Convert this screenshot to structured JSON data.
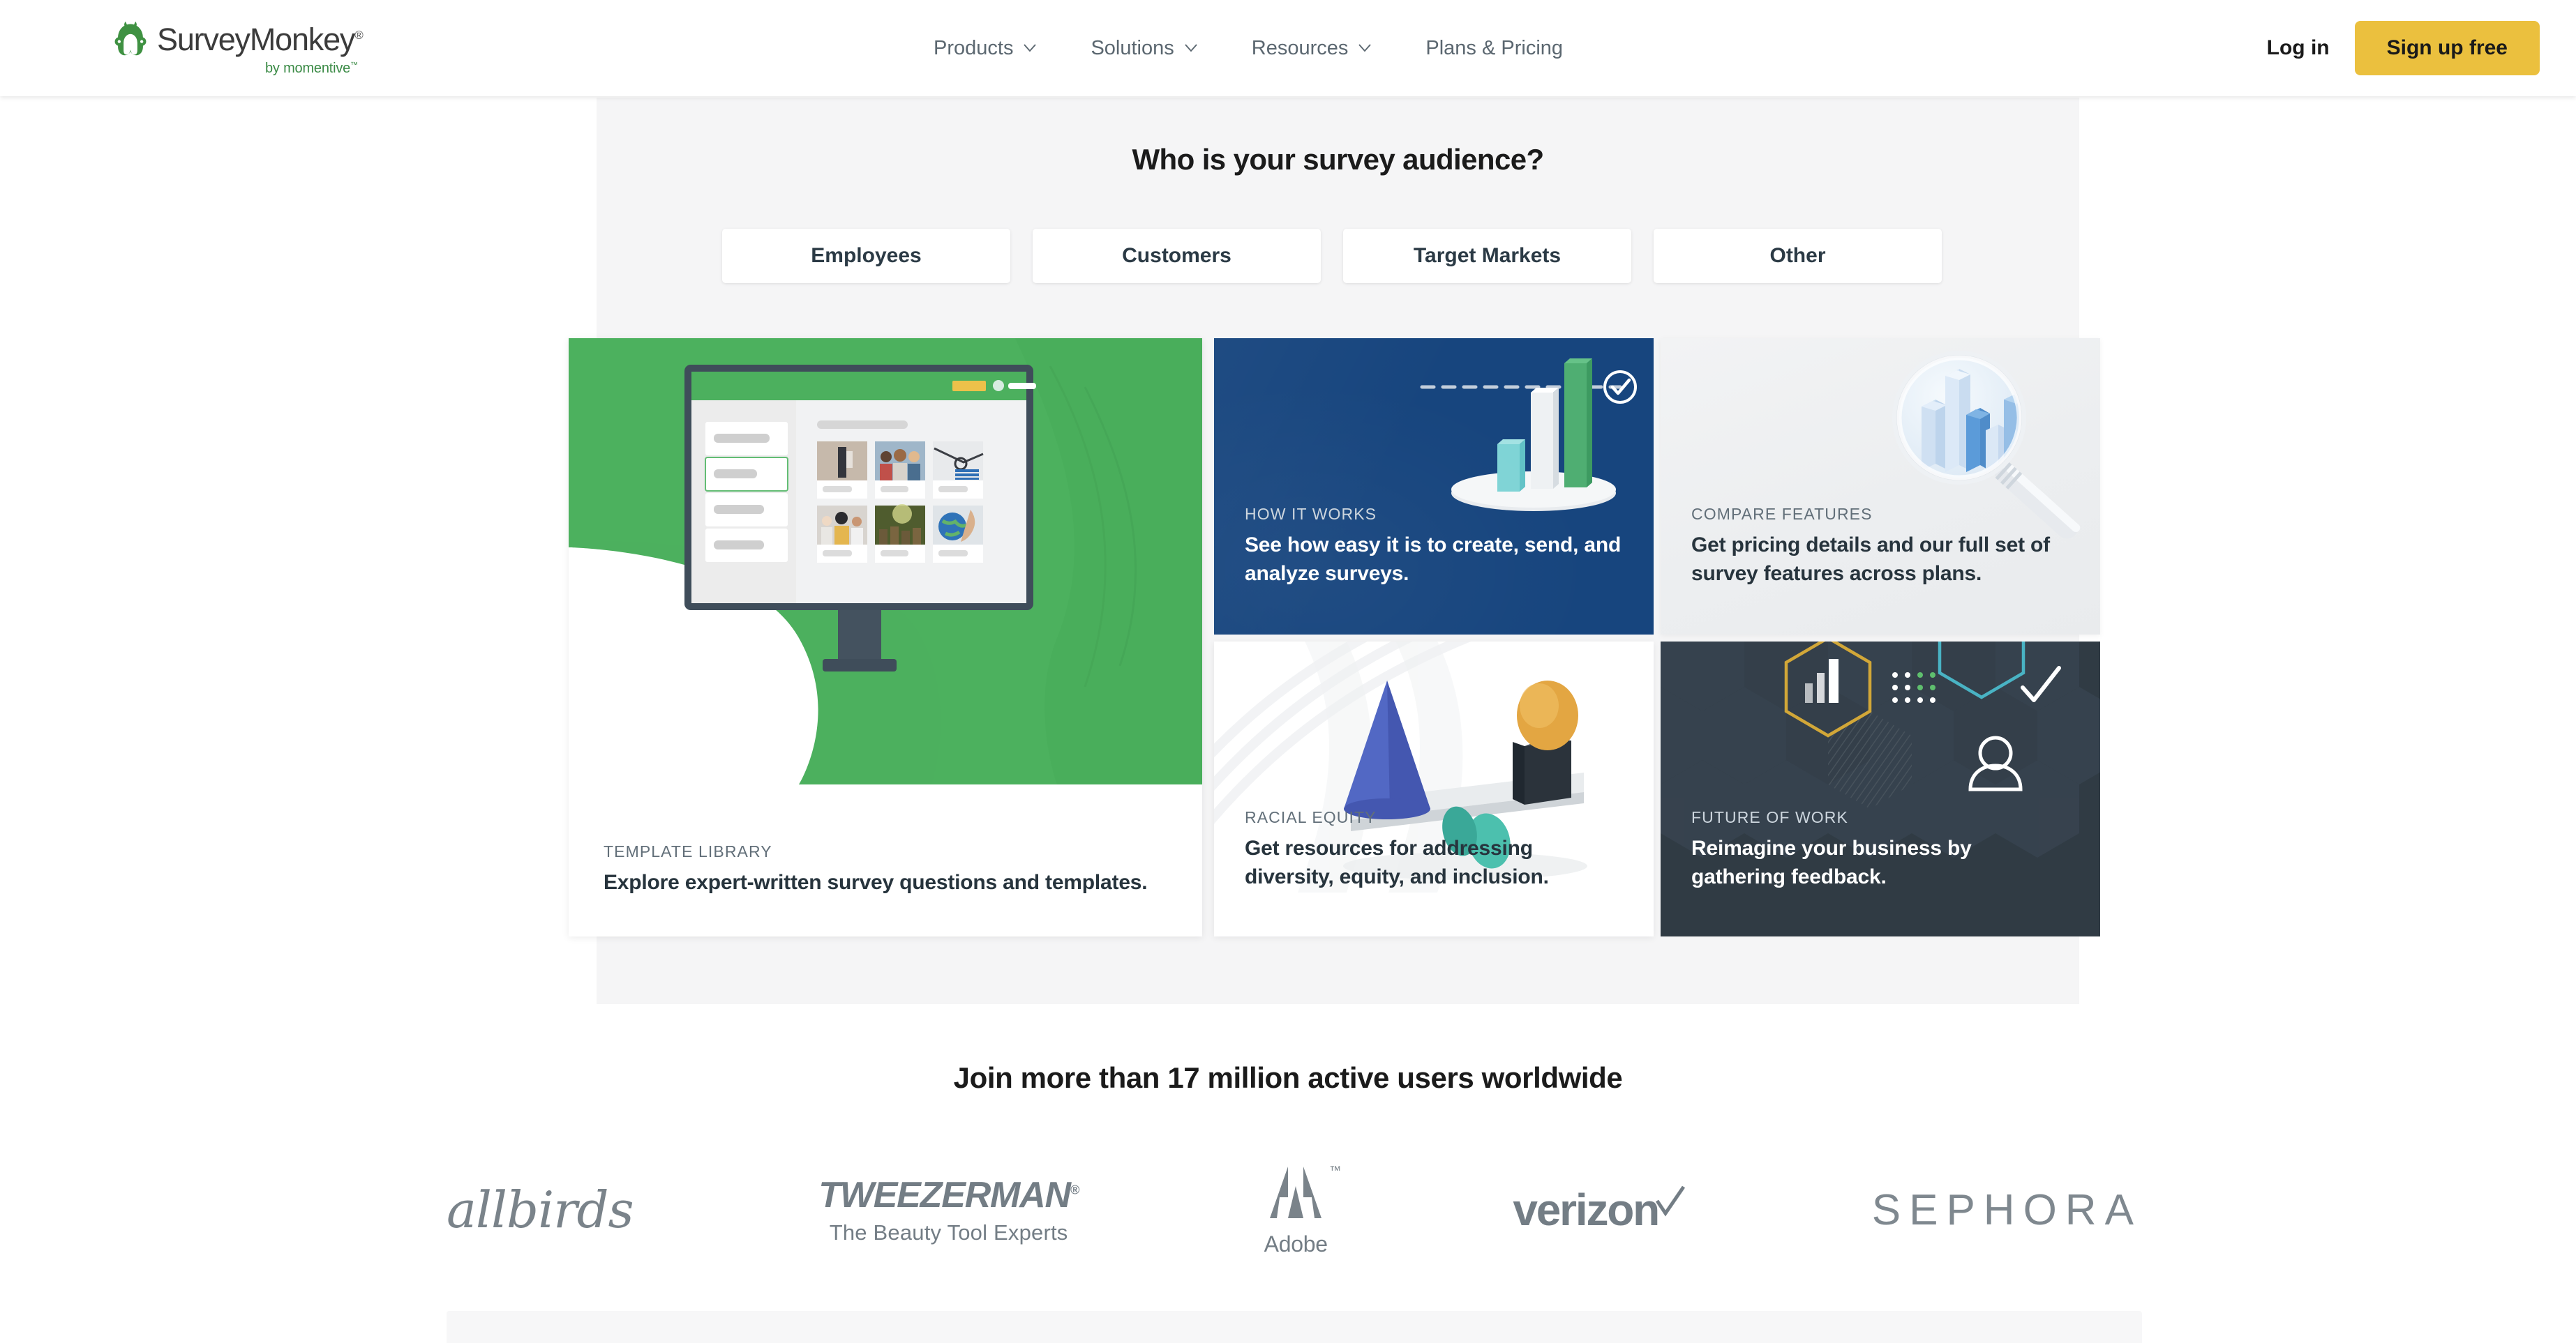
{
  "header": {
    "logo": {
      "name": "SurveyMonkey",
      "registered": "®",
      "tagline": "by momentive",
      "tagline_tm": "™"
    },
    "nav": [
      {
        "label": "Products",
        "has_chevron": true,
        "icon": "chevron-down-icon"
      },
      {
        "label": "Solutions",
        "has_chevron": true,
        "icon": "chevron-down-icon"
      },
      {
        "label": "Resources",
        "has_chevron": true,
        "icon": "chevron-down-icon"
      },
      {
        "label": "Plans & Pricing",
        "has_chevron": false,
        "icon": ""
      }
    ],
    "login_label": "Log in",
    "signup_label": "Sign up free",
    "signup_color": "#EBC03E"
  },
  "audience": {
    "title": "Who is your survey audience?",
    "tabs": [
      {
        "label": "Employees"
      },
      {
        "label": "Customers"
      },
      {
        "label": "Target Markets"
      },
      {
        "label": "Other"
      }
    ]
  },
  "cards": {
    "template_library": {
      "eyebrow": "TEMPLATE LIBRARY",
      "headline": "Explore expert-written survey questions and templates.",
      "bg_color": "#4CB05E",
      "illustration": "desktop-monitor-template-gallery"
    },
    "how_it_works": {
      "eyebrow": "HOW IT WORKS",
      "headline": "See how easy it is to create, send, and analyze surveys.",
      "bg_color": "#17457E",
      "illustration": "3d-bar-chart-with-checkmark"
    },
    "compare_features": {
      "eyebrow": "COMPARE FEATURES",
      "headline": "Get pricing details and our full set of survey features across plans.",
      "bg_color": "#EEF0F1",
      "illustration": "magnifying-glass-over-bar-chart"
    },
    "racial_equity": {
      "eyebrow": "RACIAL EQUITY",
      "headline": "Get resources for addressing diversity, equity, and inclusion.",
      "bg_color": "#FFFFFF",
      "illustration": "balance-scale-with-shapes"
    },
    "future_of_work": {
      "eyebrow": "FUTURE OF WORK",
      "headline": "Reimagine your business by gathering feedback.",
      "bg_color": "#303B44",
      "illustration": "hexagon-grid-icons"
    }
  },
  "social_proof": {
    "title": "Join more than 17 million active users worldwide",
    "brands": [
      {
        "name": "allbirds"
      },
      {
        "name": "TWEEZERMAN",
        "registered": "®",
        "subtitle": "The Beauty Tool Experts"
      },
      {
        "name": "Adobe",
        "tm": "™"
      },
      {
        "name": "verizon"
      },
      {
        "name": "SEPHORA"
      }
    ]
  }
}
